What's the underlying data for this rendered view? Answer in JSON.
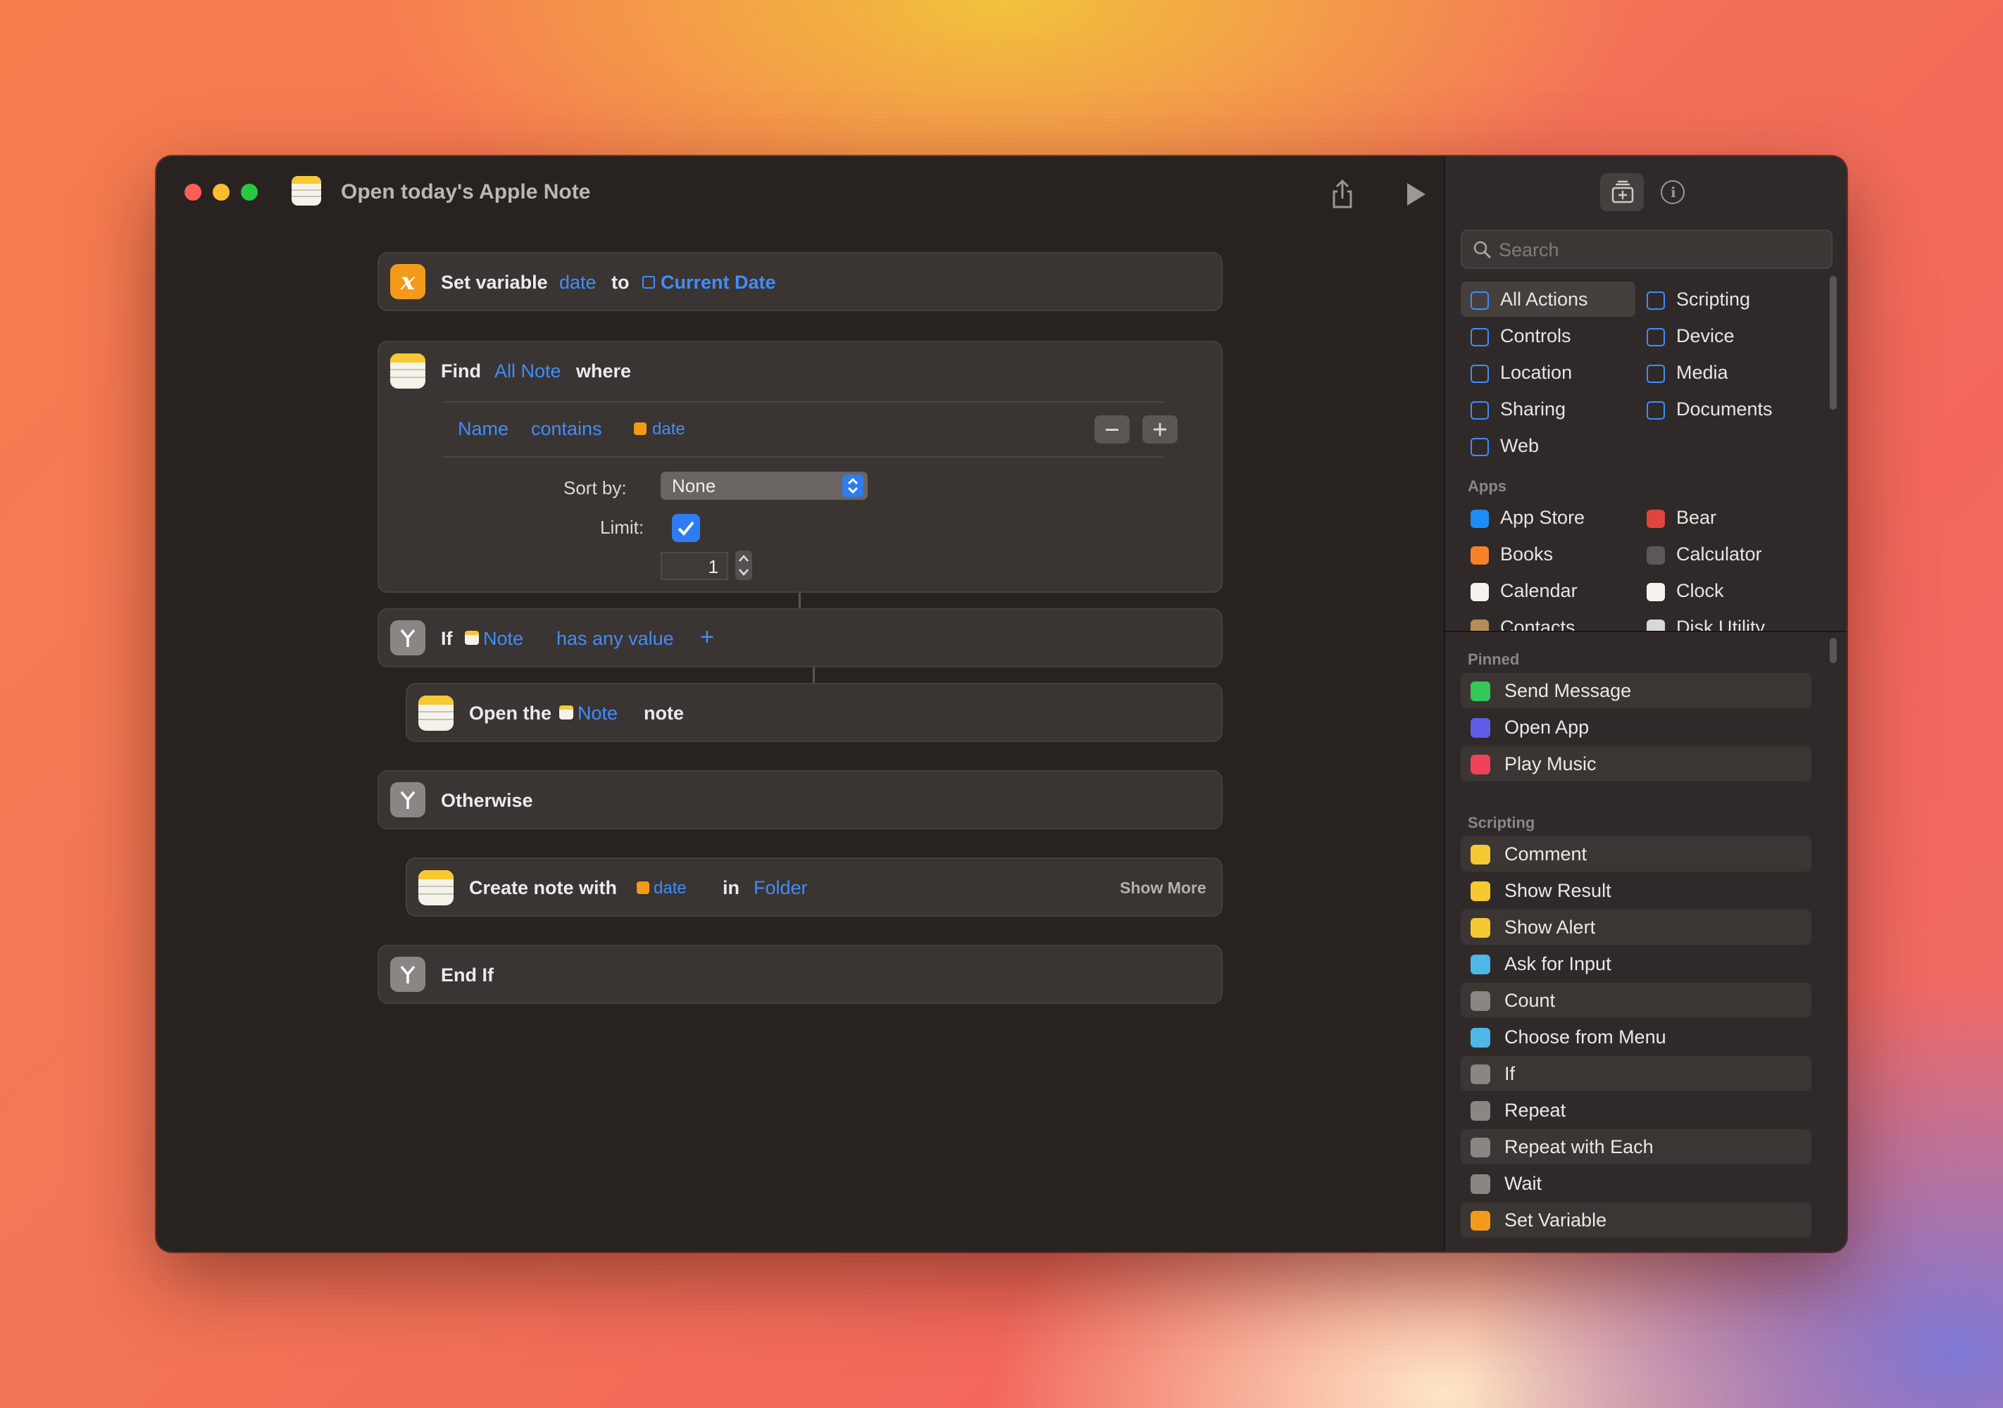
{
  "window": {
    "title": "Open today's Apple Note"
  },
  "workflow": {
    "set_variable": {
      "label": "Set variable",
      "var": "date",
      "to": "to",
      "value": "Current Date"
    },
    "find": {
      "label": "Find",
      "scope": "All Note",
      "where": "where",
      "filter": {
        "field": "Name",
        "op": "contains",
        "value": "date"
      },
      "sort_label": "Sort by:",
      "sort_value": "None",
      "limit_label": "Limit:",
      "limit_value": "1"
    },
    "if_block": {
      "label": "If",
      "subject": "Note",
      "condition": "has any value",
      "add": "+"
    },
    "open_note": {
      "label": "Open the",
      "note": "Note",
      "suffix": "note"
    },
    "otherwise": {
      "label": "Otherwise"
    },
    "create_note": {
      "label": "Create note with",
      "var": "date",
      "in": "in",
      "folder": "Folder",
      "show_more": "Show More"
    },
    "end_if": {
      "label": "End If"
    }
  },
  "sidebar": {
    "search_placeholder": "Search",
    "categories": [
      {
        "label": "All Actions",
        "icon": "list-icon",
        "color": "#3f8efc"
      },
      {
        "label": "Scripting",
        "icon": "scripting-icon",
        "color": "#3f8efc"
      },
      {
        "label": "Controls",
        "icon": "toggle-icon",
        "color": "#3f8efc"
      },
      {
        "label": "Device",
        "icon": "display-icon",
        "color": "#3f8efc"
      },
      {
        "label": "Location",
        "icon": "location-arrow-icon",
        "color": "#3f8efc"
      },
      {
        "label": "Media",
        "icon": "music-note-icon",
        "color": "#3f8efc"
      },
      {
        "label": "Sharing",
        "icon": "share-icon",
        "color": "#3f8efc"
      },
      {
        "label": "Documents",
        "icon": "document-icon",
        "color": "#3f8efc"
      },
      {
        "label": "Web",
        "icon": "compass-icon",
        "color": "#3f8efc"
      }
    ],
    "apps_title": "Apps",
    "apps": [
      {
        "label": "App Store",
        "color": "#1d8df5"
      },
      {
        "label": "Bear",
        "color": "#e0443e"
      },
      {
        "label": "Books",
        "color": "#f5822a"
      },
      {
        "label": "Calculator",
        "color": "#5b5857"
      },
      {
        "label": "Calendar",
        "color": "#f4f1ef"
      },
      {
        "label": "Clock",
        "color": "#f4f1ef"
      },
      {
        "label": "Contacts",
        "color": "#b58b5b"
      },
      {
        "label": "Disk Utility",
        "color": "#d8d8d8"
      }
    ],
    "pinned_title": "Pinned",
    "pinned": [
      {
        "label": "Send Message",
        "icon": "message-icon",
        "color": "#34c759"
      },
      {
        "label": "Open App",
        "icon": "open-app-icon",
        "color": "#5e5ce6"
      },
      {
        "label": "Play Music",
        "icon": "music-icon",
        "color": "#f0415a"
      }
    ],
    "scripting_title": "Scripting",
    "scripting": [
      {
        "label": "Comment",
        "icon": "comment-icon",
        "color": "#f6c933"
      },
      {
        "label": "Show Result",
        "icon": "show-result-icon",
        "color": "#f6c933"
      },
      {
        "label": "Show Alert",
        "icon": "alert-icon",
        "color": "#f6c933"
      },
      {
        "label": "Ask for Input",
        "icon": "input-icon",
        "color": "#4fb6e8"
      },
      {
        "label": "Count",
        "icon": "sigma-icon",
        "color": "#8a8684"
      },
      {
        "label": "Choose from Menu",
        "icon": "menu-icon",
        "color": "#4fb6e8"
      },
      {
        "label": "If",
        "icon": "if-icon",
        "color": "#8a8684"
      },
      {
        "label": "Repeat",
        "icon": "repeat-icon",
        "color": "#8a8684"
      },
      {
        "label": "Repeat with Each",
        "icon": "repeat-each-icon",
        "color": "#8a8684"
      },
      {
        "label": "Wait",
        "icon": "wait-icon",
        "color": "#8a8684"
      },
      {
        "label": "Set Variable",
        "icon": "variable-icon",
        "color": "#f39a1a"
      }
    ]
  }
}
